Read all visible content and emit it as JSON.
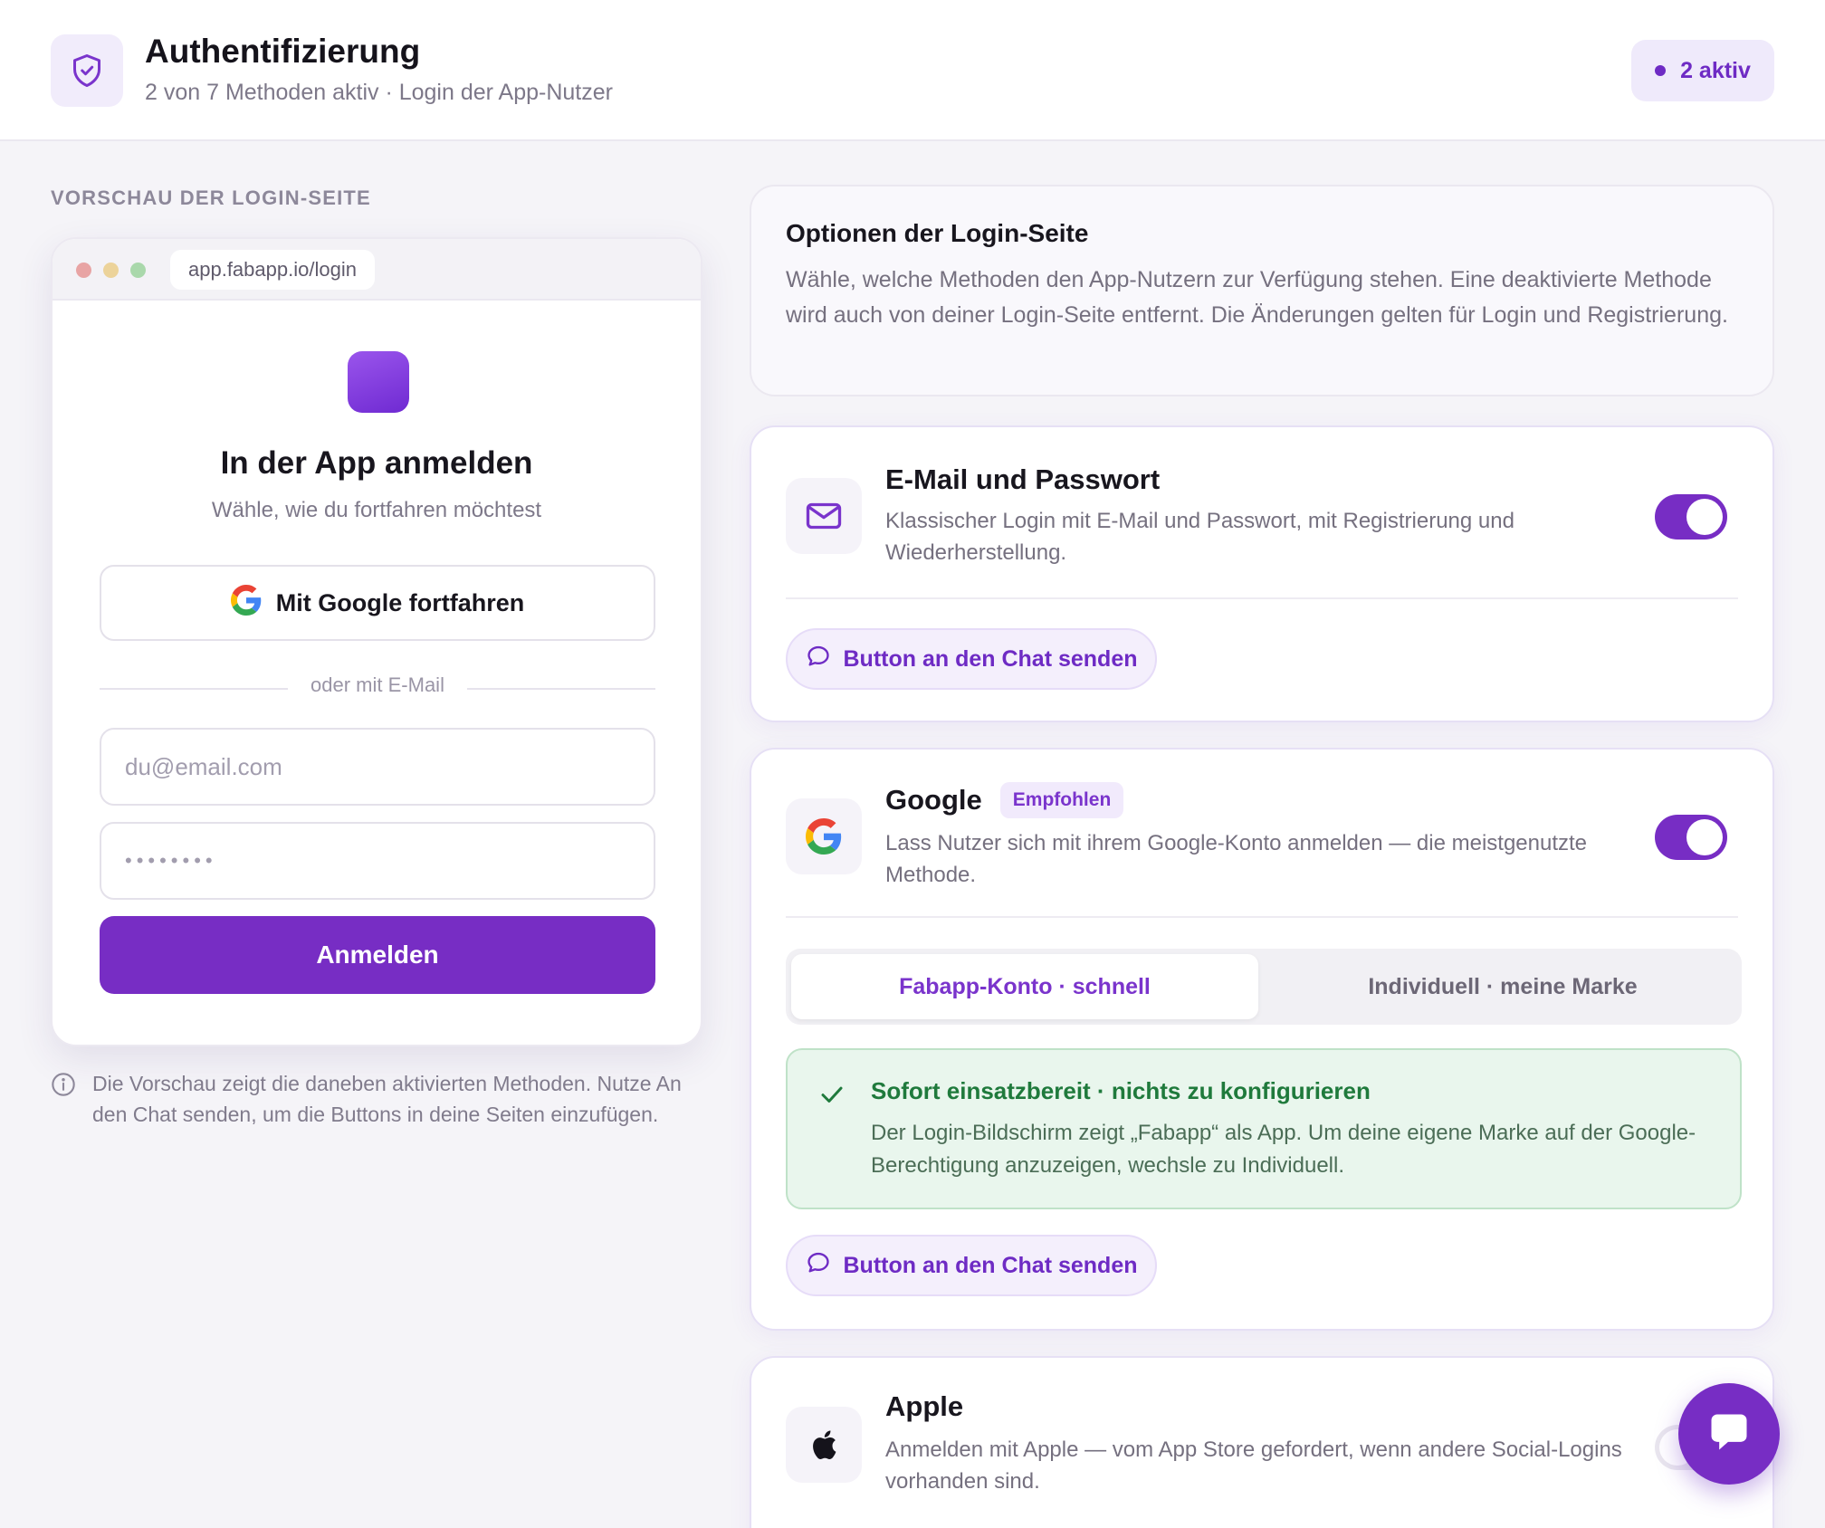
{
  "header": {
    "title": "Authentifizierung",
    "subtitle": "2 von 7 Methoden aktiv · Login der App-Nutzer",
    "badge": "2 aktiv",
    "icon": "shield-check-icon"
  },
  "preview": {
    "section_label": "VORSCHAU DER LOGIN-SEITE",
    "url": "app.fabapp.io/login",
    "title": "In der App anmelden",
    "subtitle": "Wähle, wie du fortfahren möchtest",
    "google_button": "Mit Google fortfahren",
    "divider": "oder mit E-Mail",
    "email_placeholder": "du@email.com",
    "password_mask": "••••••••",
    "submit": "Anmelden",
    "note": "Die Vorschau zeigt die daneben aktivierten Methoden. Nutze An den Chat senden, um die Buttons in deine Seiten einzufügen."
  },
  "options": {
    "title": "Optionen der Login-Seite",
    "description": "Wähle, welche Methoden den App-Nutzern zur Verfügung stehen. Eine deaktivierte Methode wird auch von deiner Login-Seite entfernt. Die Änderungen gelten für Login und Registrierung."
  },
  "methods": [
    {
      "title": "E-Mail und Passwort",
      "description": "Klassischer Login mit E-Mail und Passwort, mit Registrierung und Wiederherstellung.",
      "enabled": true,
      "icon": "mail-icon",
      "chat_button": "Button an den Chat senden"
    },
    {
      "title": "Google",
      "badge": "Empfohlen",
      "description": "Lass Nutzer sich mit ihrem Google-Konto anmelden — die meistgenutzte Methode.",
      "enabled": true,
      "icon": "google-icon",
      "segments": [
        "Fabapp-Konto · schnell",
        "Individuell · meine Marke"
      ],
      "selected_segment": "Fabapp-Konto · schnell",
      "notice_title": "Sofort einsatzbereit · nichts zu konfigurieren",
      "notice_text": "Der Login-Bildschirm zeigt „Fabapp“ als App. Um deine eigene Marke auf der Google-Berechtigung anzuzeigen, wechsle zu Individuell.",
      "chat_button": "Button an den Chat senden"
    },
    {
      "title": "Apple",
      "description": "Anmelden mit Apple — vom App Store gefordert, wenn andere Social-Logins vorhanden sind.",
      "enabled": false,
      "icon": "apple-icon"
    }
  ],
  "colors": {
    "accent": "#772dc4",
    "success_bg": "#e9f6ed",
    "success_text": "#1f7a3c"
  },
  "fab_icon": "chat-bubble-icon"
}
